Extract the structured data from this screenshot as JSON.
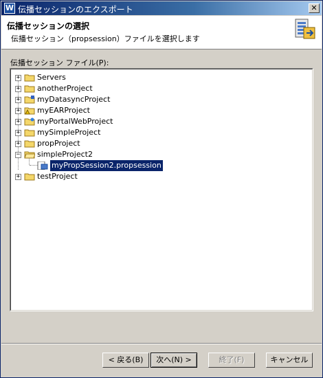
{
  "window": {
    "title": "伝播セッションのエクスポート",
    "close_glyph": "✕",
    "app_glyph": "W"
  },
  "header": {
    "title": "伝播セッションの選択",
    "description": "伝播セッション（propsession）ファイルを選択します"
  },
  "tree": {
    "label": "伝播セッション ファイル(P):",
    "items": [
      {
        "label": "Servers",
        "expanded": false
      },
      {
        "label": "anotherProject",
        "expanded": false
      },
      {
        "label": "myDatasyncProject",
        "expanded": false
      },
      {
        "label": "myEARProject",
        "expanded": false
      },
      {
        "label": "myPortalWebProject",
        "expanded": false
      },
      {
        "label": "mySimpleProject",
        "expanded": false
      },
      {
        "label": "propProject",
        "expanded": false
      },
      {
        "label": "simpleProject2",
        "expanded": true
      },
      {
        "label": "myPropSession2.propsession",
        "selected": true
      },
      {
        "label": "testProject",
        "expanded": false
      }
    ],
    "expand_glyph": "+",
    "collapse_glyph": "−"
  },
  "buttons": {
    "back": "< 戻る(B)",
    "next": "次へ(N) >",
    "finish": "終了(F)",
    "cancel": "キャンセル"
  }
}
